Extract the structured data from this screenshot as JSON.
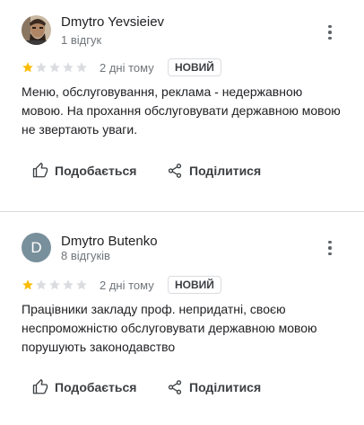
{
  "colors": {
    "star_filled": "#fbbc04",
    "star_empty": "#dadce0",
    "avatar_letter_bg": "#78909c"
  },
  "actions": {
    "like_label": "Подобається",
    "share_label": "Поділитися",
    "like_icon": "thumb-up-icon",
    "share_icon": "share-icon",
    "more_icon": "more-vert-icon"
  },
  "reviews": [
    {
      "author": "Dmytro Yevsieiev",
      "review_count": "1 відгук",
      "avatar": "photo",
      "rating": 1,
      "max_rating": 5,
      "date": "2 дні тому",
      "badge": "НОВИЙ",
      "text": "Меню, обслуговування, реклама - недержавною мовою. На прохання  обслуговувати державною мовою не звертають уваги."
    },
    {
      "author": "Dmytro Butenko",
      "review_count": "8 відгуків",
      "avatar": "D",
      "rating": 1,
      "max_rating": 5,
      "date": "2 дні тому",
      "badge": "НОВИЙ",
      "text": "Працівники закладу проф. непридатні, своєю неспроможністю обслуговувати державною мовою порушують законодавство"
    }
  ]
}
